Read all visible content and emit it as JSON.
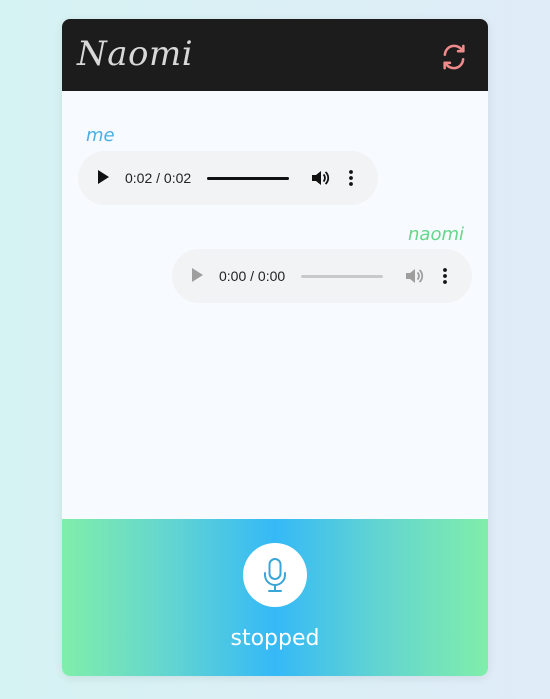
{
  "header": {
    "title": "Naomi",
    "refresh_icon": "refresh-icon",
    "accent": "#f08b8b"
  },
  "messages": [
    {
      "sender": "me",
      "player": {
        "time_display": "0:02 / 0:02",
        "progress": 1.0
      }
    },
    {
      "sender": "naomi",
      "player": {
        "time_display": "0:00 / 0:00",
        "progress": 0.0
      }
    }
  ],
  "footer": {
    "status": "stopped",
    "mic_icon": "microphone-icon",
    "mic_color": "#3aa6d8"
  }
}
